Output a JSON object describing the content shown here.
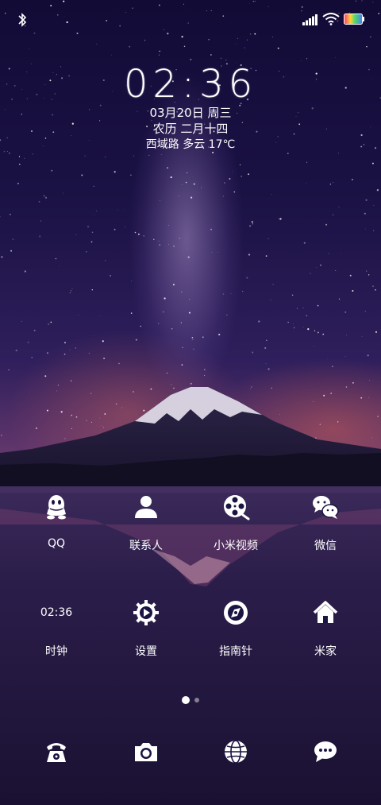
{
  "status_bar": {
    "left_icon": "bluetooth-icon",
    "right_icons": [
      "signal-icon",
      "wifi-icon",
      "battery-icon"
    ]
  },
  "lockscreen": {
    "time": "02:36",
    "date": "03月20日 周三",
    "lunar": "农历 二月十四",
    "weather": "西域路 多云 17℃"
  },
  "apps_row1": [
    {
      "label": "QQ",
      "icon": "qq-penguin-icon"
    },
    {
      "label": "联系人",
      "icon": "contacts-person-icon"
    },
    {
      "label": "小米视频",
      "icon": "film-reel-icon"
    },
    {
      "label": "微信",
      "icon": "wechat-icon"
    }
  ],
  "apps_row2": [
    {
      "label": "时钟",
      "widget_text": "02:36"
    },
    {
      "label": "设置",
      "icon": "settings-gear-icon"
    },
    {
      "label": "指南针",
      "icon": "compass-icon"
    },
    {
      "label": "米家",
      "icon": "home-icon"
    }
  ],
  "pager": {
    "pages": 2,
    "current": 1
  },
  "dock": [
    "phone-icon",
    "camera-icon",
    "browser-globe-icon",
    "messages-icon"
  ]
}
